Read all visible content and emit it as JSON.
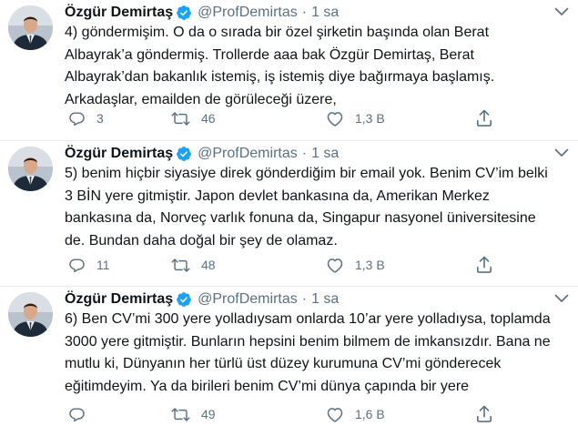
{
  "tweets": [
    {
      "name": "Özgür Demirtaş",
      "handle": "@ProfDemirtas",
      "separator": "·",
      "time": "1 sa",
      "lines": [
        "4) göndermişim. O da o sırada bir özel şirketin başında olan Berat",
        "Albayrak’a göndermiş. Trollerde aaa bak Özgür Demirtaş, Berat",
        "Albayrak’dan bakanlık istemiş, iş istemiş diye bağırmaya başlamış.",
        "Arkadaşlar, emailden de görüleceği üzere,"
      ],
      "replies": "3",
      "retweets": "46",
      "likes": "1,3 B"
    },
    {
      "name": "Özgür Demirtaş",
      "handle": "@ProfDemirtas",
      "separator": "·",
      "time": "1 sa",
      "lines": [
        "5) benim hiçbir siyasiye direk gönderdiğim bir email yok. Benim CV’im belki",
        "3 BİN yere gitmiştir. Japon devlet bankasına da, Amerikan Merkez",
        "bankasına da, Norveç varlık fonuna da, Singapur nasyonel üniversitesine",
        "de. Bundan daha doğal bir şey de olamaz."
      ],
      "replies": "11",
      "retweets": "48",
      "likes": "1,3 B"
    },
    {
      "name": "Özgür Demirtaş",
      "handle": "@ProfDemirtas",
      "separator": "·",
      "time": "1 sa",
      "lines": [
        "6) Ben CV’mi 300 yere yolladıysam onlarda 10’ar yere yolladıysa, toplamda",
        "3000 yere gitmiştir. Bunların hepsini benim bilmem de imkansızdır. Bana ne",
        "mutlu ki, Dünyanın her türlü üst düzey kurumuna CV’mi gönderecek",
        "eğitimdeyim. Ya da birileri benim CV’mi dünya çapında bir yere"
      ],
      "replies": "",
      "retweets": "49",
      "likes": "1,6 B"
    }
  ],
  "icons": {
    "verified": "verified-badge-icon",
    "caret": "chevron-down-icon",
    "reply": "reply-icon",
    "retweet": "retweet-icon",
    "like": "heart-icon",
    "share": "share-icon"
  },
  "colors": {
    "text": "#0f1419",
    "secondary": "#5b7083",
    "verified": "#1da1f2",
    "divider": "#e6ecf0"
  }
}
